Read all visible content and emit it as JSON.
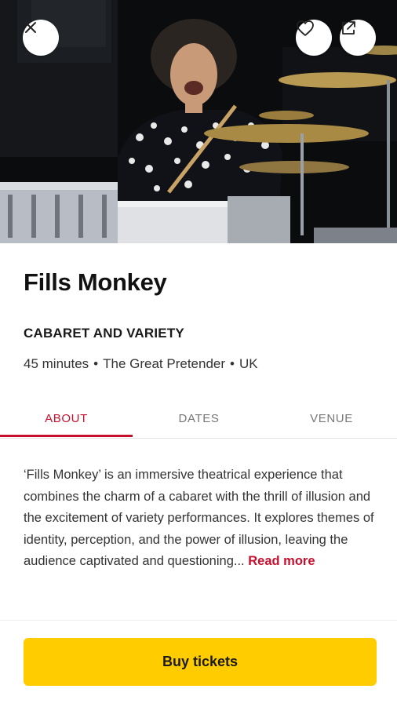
{
  "hero": {
    "close_icon": "close-icon",
    "favorite_icon": "heart-icon",
    "share_icon": "share-icon"
  },
  "show": {
    "title": "Fills Monkey",
    "category": "CABARET AND VARIETY",
    "duration": "45 minutes",
    "venue": "The Great Pretender",
    "country": "UK",
    "separator": "•"
  },
  "tabs": [
    {
      "label": "ABOUT",
      "active": true
    },
    {
      "label": "DATES",
      "active": false
    },
    {
      "label": "VENUE",
      "active": false
    }
  ],
  "about": {
    "text": "‘Fills Monkey’ is an immersive theatrical experience that combines the charm of a cabaret with the thrill of illusion and the excitement of variety performances. It explores themes of identity, perception, and the power of illusion, leaving the audience captivated and questioning...",
    "read_more": "Read more"
  },
  "footer": {
    "buy_label": "Buy tickets"
  },
  "colors": {
    "accent": "#c8102e",
    "button": "#ffcc00"
  }
}
